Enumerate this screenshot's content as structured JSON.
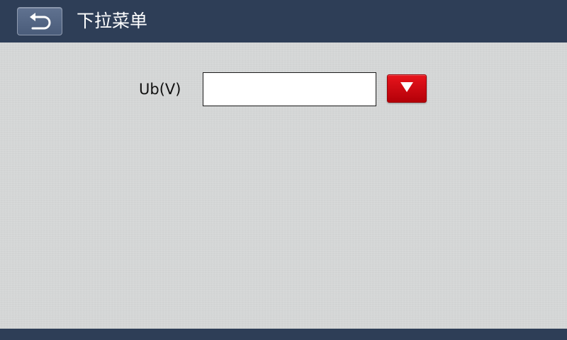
{
  "header": {
    "title": "下拉菜单",
    "back_icon": "back-arrow-icon"
  },
  "form": {
    "label": "Ub(V)",
    "value": "",
    "dropdown_icon": "triangle-down-icon"
  },
  "colors": {
    "header_bg": "#2e3e57",
    "page_bg": "#d6d8d8",
    "dropdown_button": "#d50910"
  }
}
